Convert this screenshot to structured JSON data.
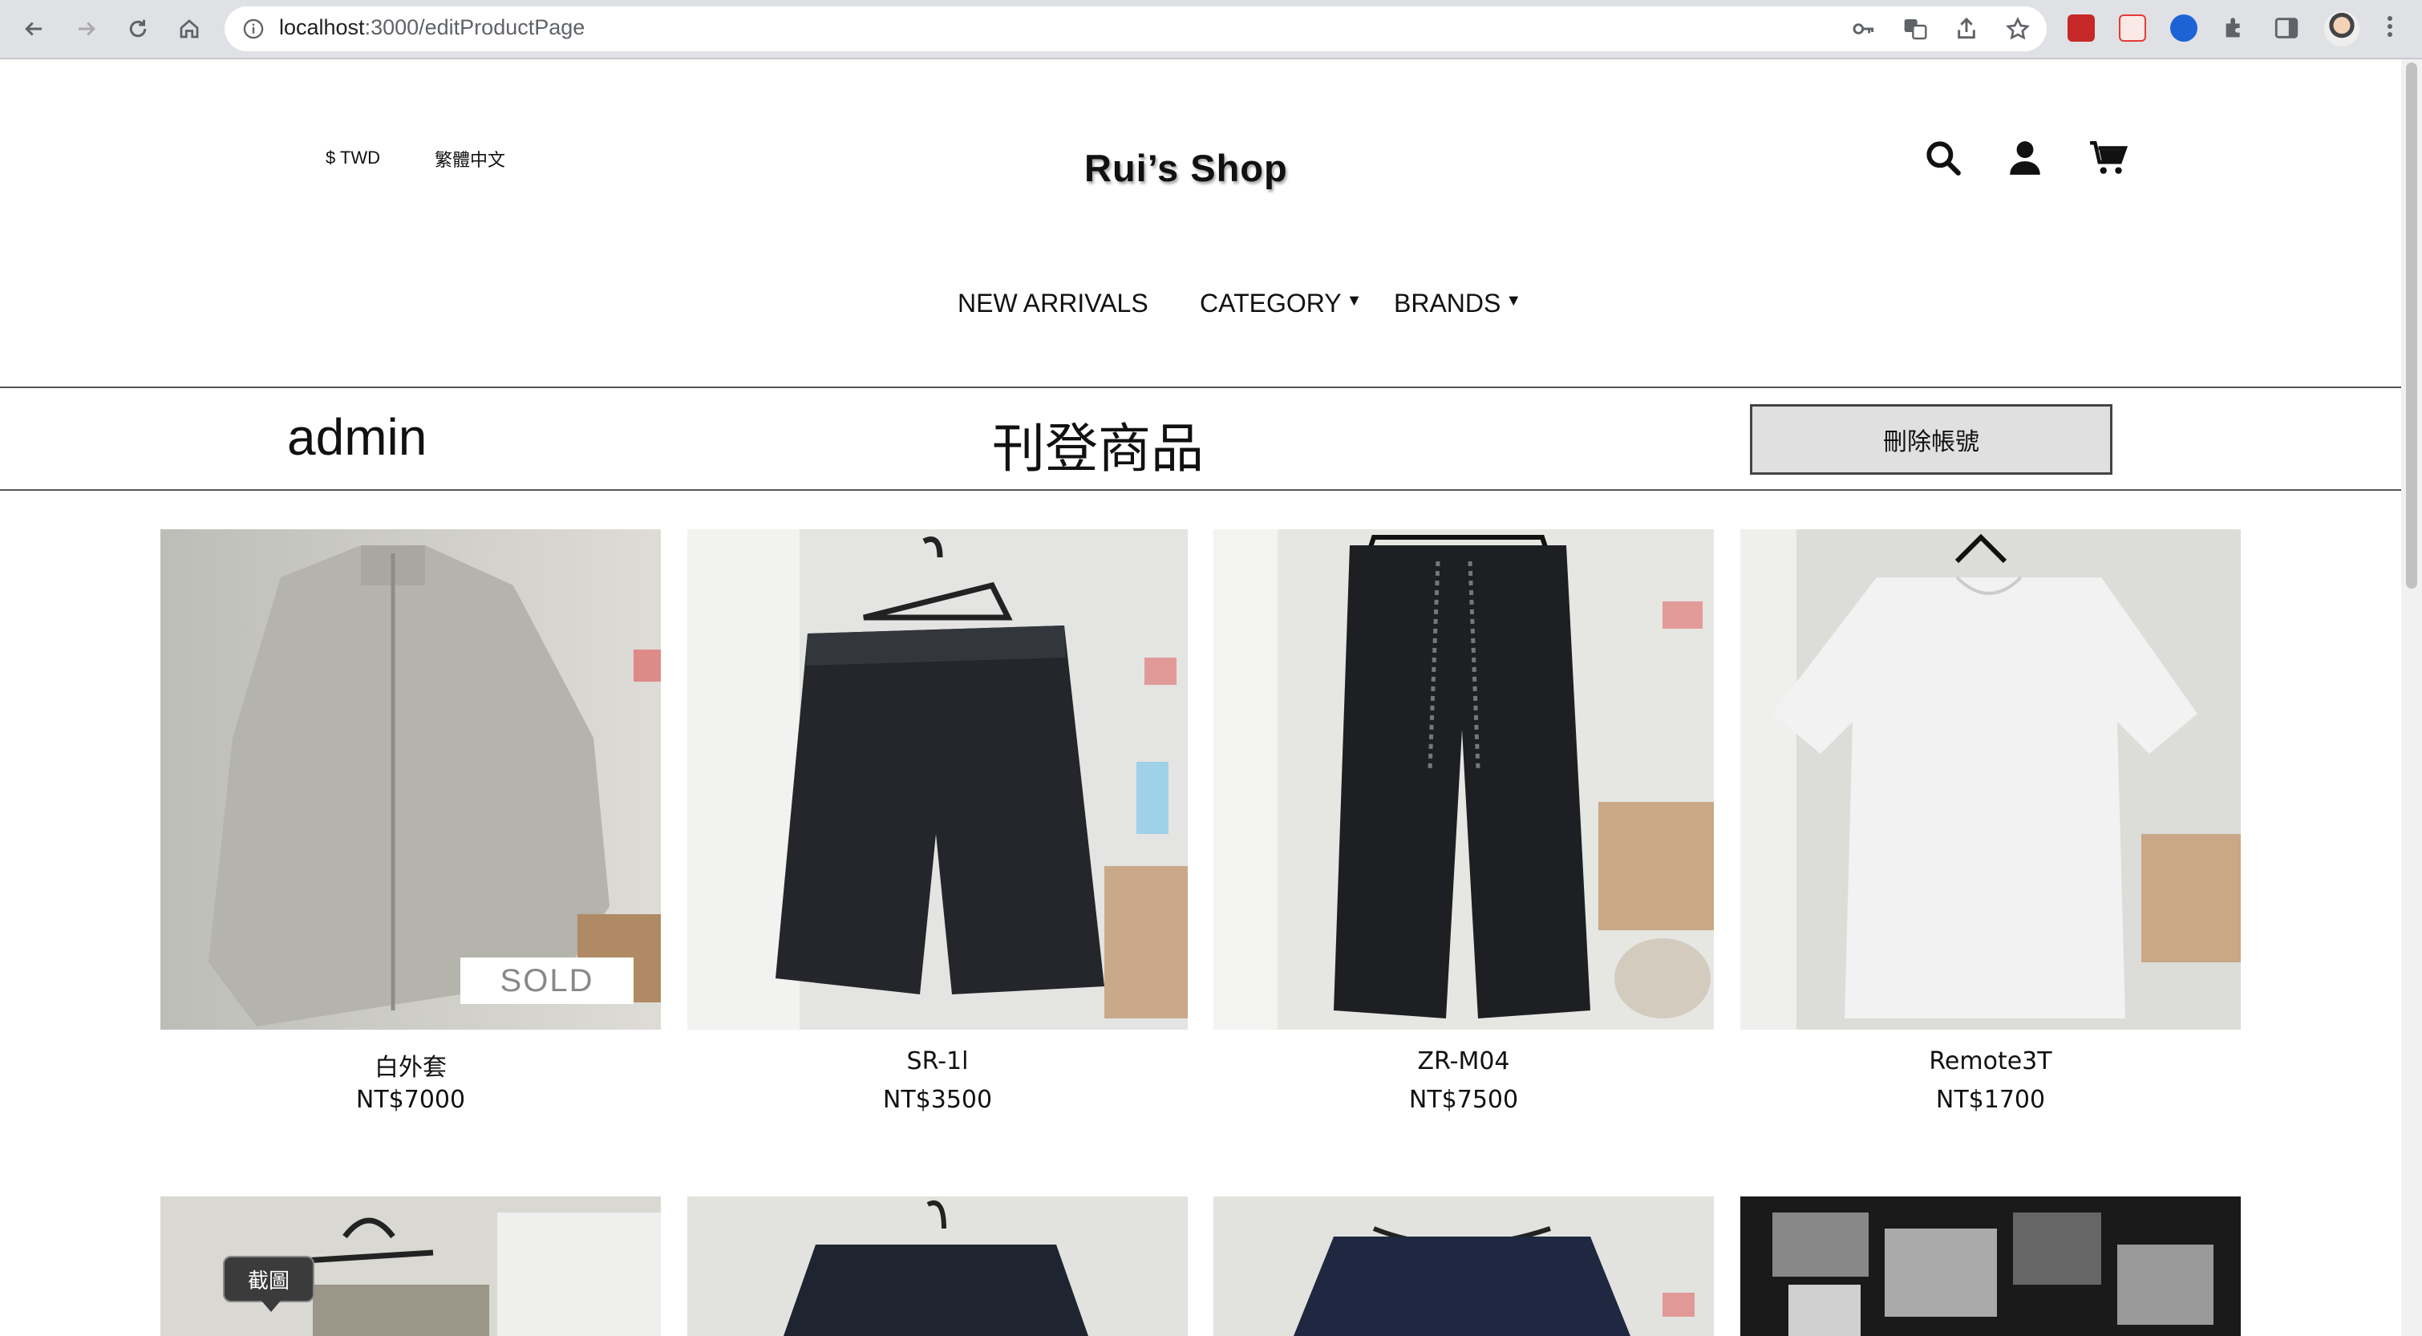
{
  "browser": {
    "url_host": "localhost",
    "url_path": ":3000/editProductPage"
  },
  "header": {
    "currency": "$ TWD",
    "language": "繁體中文",
    "logo": "Rui’s Shop",
    "icons": [
      "search-icon",
      "user-icon",
      "cart-icon"
    ]
  },
  "nav": {
    "new_arrivals": "NEW ARRIVALS",
    "category": "CATEGORY",
    "brands": "BRANDS",
    "caret": "▼"
  },
  "admin_bar": {
    "username": "admin",
    "title": "刊登商品",
    "delete_button": "刪除帳號"
  },
  "products": [
    {
      "name": "白外套",
      "price": "NT$7000",
      "sold_label": "SOLD"
    },
    {
      "name": "SR-1l",
      "price": "NT$3500"
    },
    {
      "name": "ZR-M04",
      "price": "NT$7500"
    },
    {
      "name": "Remote3T",
      "price": "NT$1700"
    }
  ],
  "tooltip": "截圖",
  "colors": {
    "chrome": "#dfe1e5",
    "button_bg": "#e0e0e0",
    "text": "#111111"
  }
}
